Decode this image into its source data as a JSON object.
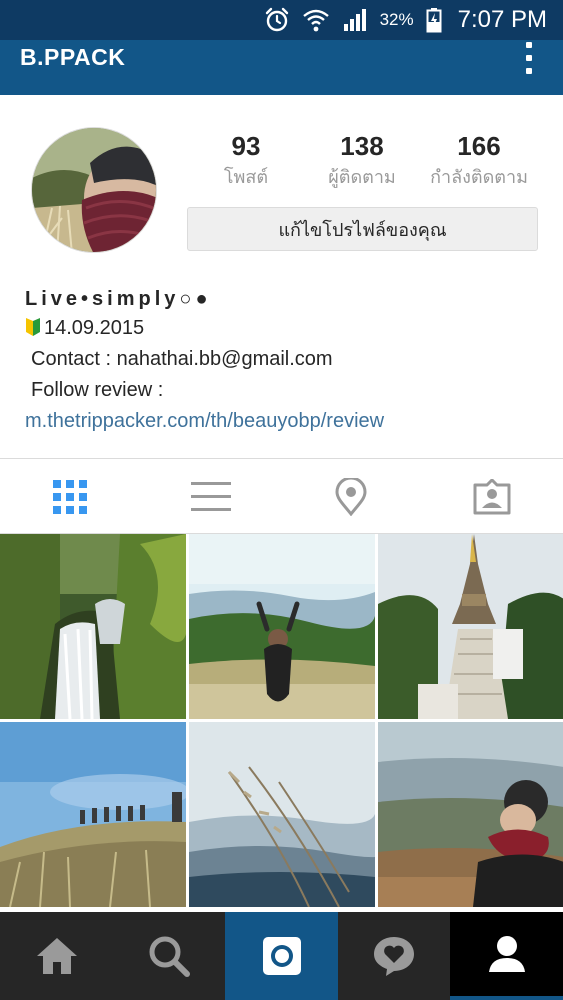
{
  "status_bar": {
    "battery": "32%",
    "time": "7:07 PM",
    "icons": [
      "alarm-icon",
      "wifi-icon",
      "signal-icon",
      "battery-charging-icon"
    ]
  },
  "app_bar": {
    "username": "B.PPACK",
    "overflow_icon": "more-vert-icon"
  },
  "profile": {
    "stats": [
      {
        "value": "93",
        "label": "โพสต์"
      },
      {
        "value": "138",
        "label": "ผู้ติดตาม"
      },
      {
        "value": "166",
        "label": "กำลังติดตาม"
      }
    ],
    "edit_button": "แก้ไขโปรไฟล์ของคุณ"
  },
  "bio": {
    "name": "Live•simply○●",
    "since": "14.09.2015",
    "contact": "Contact : nahathai.bb@gmail.com",
    "follow_review": "Follow review :",
    "link": "m.thetrippacker.com/th/beauyobp/review"
  },
  "tabs": [
    {
      "name": "grid-view",
      "icon": "grid-icon",
      "active": true
    },
    {
      "name": "list-view",
      "icon": "list-icon",
      "active": false
    },
    {
      "name": "places",
      "icon": "location-pin-icon",
      "active": false
    },
    {
      "name": "tagged",
      "icon": "tagged-person-icon",
      "active": false
    }
  ],
  "photos": [
    {
      "subject": "waterfall in forest"
    },
    {
      "subject": "person on grassy hill with mountains"
    },
    {
      "subject": "golden pagoda with stairway"
    },
    {
      "subject": "group of hikers on hillside"
    },
    {
      "subject": "grass over misty mountains"
    },
    {
      "subject": "woman in beanie and scarf overlooking valley"
    }
  ],
  "bottom_nav": [
    {
      "name": "home",
      "icon": "home-icon",
      "active": false
    },
    {
      "name": "search",
      "icon": "search-icon",
      "active": false
    },
    {
      "name": "camera",
      "icon": "camera-icon",
      "active": false
    },
    {
      "name": "activity",
      "icon": "heart-bubble-icon",
      "active": false
    },
    {
      "name": "profile",
      "icon": "profile-icon",
      "active": true
    }
  ],
  "colors": {
    "status_bar": "#0e3a63",
    "app_bar": "#125688",
    "link": "#3f729b",
    "active_tab": "#3897f0",
    "nav_background": "#262626"
  }
}
